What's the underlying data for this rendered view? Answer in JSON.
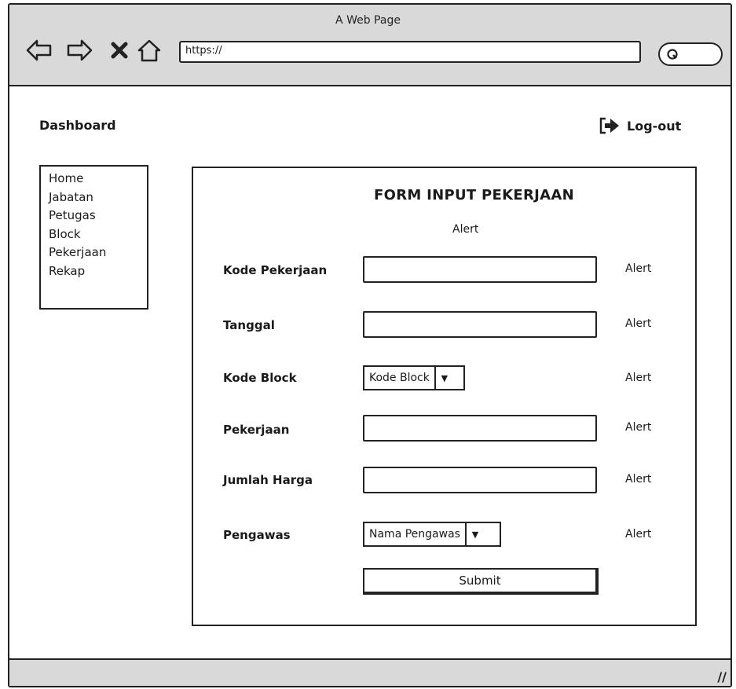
{
  "window": {
    "title": "A Web Page"
  },
  "toolbar": {
    "back_icon": "arrow-left-outline",
    "forward_icon": "arrow-right-outline",
    "close_icon": "x-mark",
    "home_icon": "house-outline",
    "url": "https://",
    "search_icon": "magnifier"
  },
  "header": {
    "dashboard_label": "Dashboard",
    "logout_label": "Log-out",
    "logout_icon": "exit-arrow"
  },
  "sidebar": {
    "items": [
      {
        "label": "Home"
      },
      {
        "label": "Jabatan"
      },
      {
        "label": "Petugas"
      },
      {
        "label": "Block"
      },
      {
        "label": "Pekerjaan"
      },
      {
        "label": "Rekap"
      }
    ]
  },
  "form": {
    "title": "FORM INPUT PEKERJAAN",
    "alert": "Alert",
    "fields": [
      {
        "label": "Kode Pekerjaan",
        "value": "",
        "alert": "Alert"
      },
      {
        "label": "Tanggal",
        "value": "",
        "alert": "Alert"
      },
      {
        "label": "Kode Block",
        "selected": "Kode Block",
        "alert": "Alert"
      },
      {
        "label": "Pekerjaan",
        "value": "",
        "alert": "Alert"
      },
      {
        "label": "Jumlah Harga",
        "value": "",
        "alert": "Alert"
      },
      {
        "label": "Pengawas",
        "selected": "Nama Pengawas",
        "alert": "Alert"
      }
    ],
    "submit_label": "Submit"
  },
  "colors": {
    "chrome_gray": "#d9d9d9",
    "stroke": "#222222"
  }
}
